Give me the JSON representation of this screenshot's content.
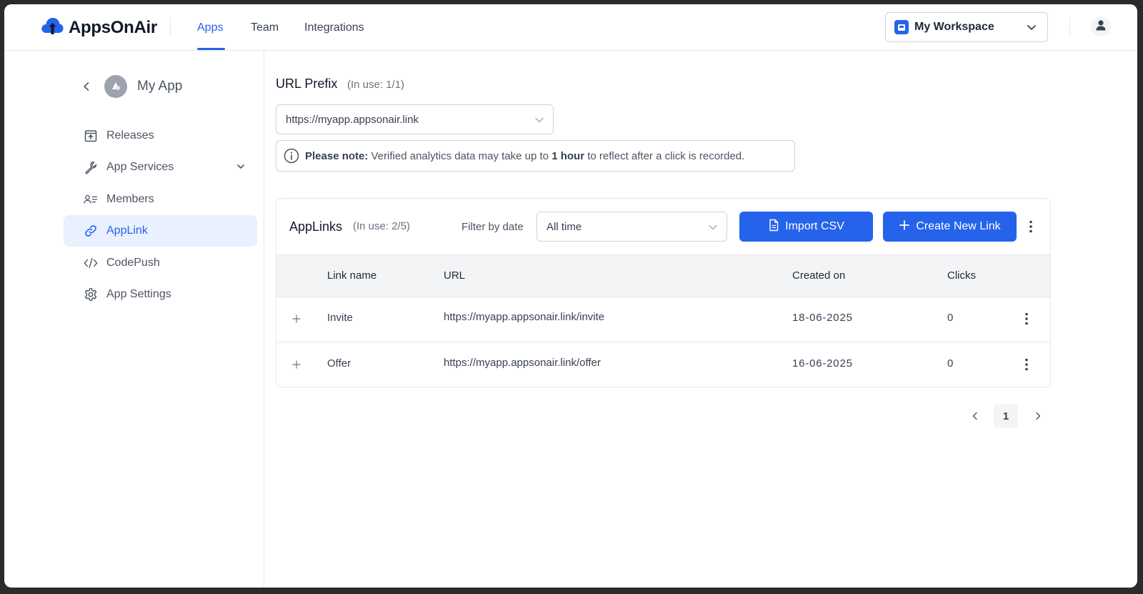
{
  "topbar": {
    "logo_text": "AppsOnAir",
    "tabs": [
      {
        "label": "Apps",
        "active": true
      },
      {
        "label": "Team",
        "active": false
      },
      {
        "label": "Integrations",
        "active": false
      }
    ],
    "workspace_label": "My Workspace"
  },
  "sidebar": {
    "app_name": "My App",
    "items": [
      {
        "label": "Releases",
        "icon": "upload-box-icon"
      },
      {
        "label": "App Services",
        "icon": "wrench-icon",
        "has_chevron": true
      },
      {
        "label": "Members",
        "icon": "members-icon"
      },
      {
        "label": "AppLink",
        "icon": "link-icon",
        "active": true
      },
      {
        "label": "CodePush",
        "icon": "code-icon"
      },
      {
        "label": "App Settings",
        "icon": "gear-icon"
      }
    ]
  },
  "main": {
    "prefix_title": "URL Prefix",
    "prefix_usage": "(In use: 1/1)",
    "prefix_value": "https://myapp.appsonair.link",
    "note": {
      "bold_label": "Please note:",
      "text_before": "Verified analytics data may take up to",
      "bold_duration": "1 hour",
      "text_after": "to reflect after a click is recorded."
    },
    "card": {
      "title": "AppLinks",
      "usage": "(In use: 2/5)",
      "filter_label": "Filter by date",
      "filter_value": "All time",
      "import_label": "Import CSV",
      "create_label": "Create New Link"
    },
    "table": {
      "columns": [
        "Link name",
        "URL",
        "Created on",
        "Clicks"
      ],
      "rows": [
        {
          "name": "Invite",
          "url": "https://myapp.appsonair.link/invite",
          "created": "18-06-2025",
          "clicks": "0"
        },
        {
          "name": "Offer",
          "url": "https://myapp.appsonair.link/offer",
          "created": "16-06-2025",
          "clicks": "0"
        }
      ]
    },
    "pagination": {
      "current_page": "1"
    }
  },
  "colors": {
    "accent": "#2563eb",
    "active_bg": "#e8f1fd"
  }
}
